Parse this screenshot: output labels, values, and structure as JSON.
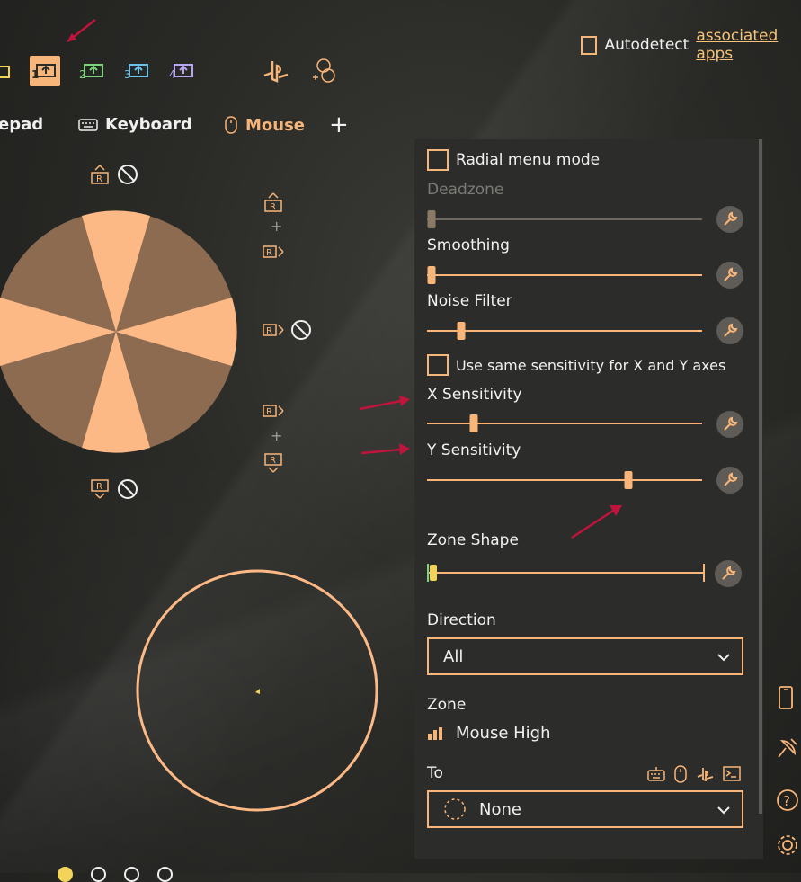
{
  "top": {
    "autodetect_label": "Autodetect",
    "associated_apps_link": "associated apps",
    "slots": [
      "1",
      "2",
      "3",
      "4"
    ]
  },
  "tabs": {
    "gamepad": "epad",
    "keyboard": "Keyboard",
    "mouse": "Mouse",
    "add": "+"
  },
  "stick_cluster": {
    "plus_1": "+",
    "plus_2": "+"
  },
  "panel": {
    "radial_menu_mode": "Radial menu mode",
    "deadzone": "Deadzone",
    "smoothing": "Smoothing",
    "noise_filter": "Noise Filter",
    "same_sensitivity": "Use same sensitivity for X and Y axes",
    "x_sensitivity": "X Sensitivity",
    "y_sensitivity": "Y Sensitivity",
    "zone_shape": "Zone Shape",
    "direction_label": "Direction",
    "direction_value": "All",
    "zone_label": "Zone",
    "zone_value": "Mouse High",
    "to_label": "To",
    "to_value": "None"
  },
  "slider_levels": {
    "deadzone": 0.0,
    "smoothing": 0.0,
    "noise_filter": 0.11,
    "x_sensitivity": 0.16,
    "y_sensitivity": 0.74
  },
  "colors": {
    "accent": "#f7b57a",
    "panel_bg": "#2c2c2a",
    "annotation_red": "#c0143c"
  },
  "icons": [
    "gamepad-icon",
    "keyboard-icon",
    "mouse-icon",
    "playstation-icon",
    "wrench-icon",
    "chevron-down-icon",
    "phone-icon",
    "satellite-icon",
    "help-icon",
    "settings-icon",
    "blocked-icon"
  ]
}
